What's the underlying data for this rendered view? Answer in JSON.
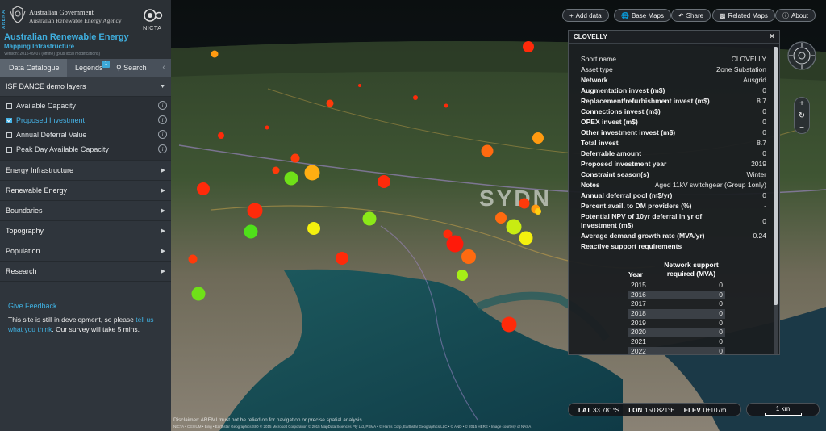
{
  "brand": {
    "arena": "ARENA",
    "gov_line1": "Australian Government",
    "gov_line2": "Australian Renewable Energy Agency",
    "partner": "NICTA",
    "title": "Australian Renewable Energy",
    "subtitle": "Mapping Infrastructure",
    "version": "Version: 2015-09-07 (offline) (plus local modifications)"
  },
  "sidebar": {
    "tabs": {
      "catalogue": "Data Catalogue",
      "legends": "Legends",
      "legends_badge": "1",
      "search": "Search"
    },
    "open_group": {
      "label": "ISF DANCE demo layers",
      "layers": [
        {
          "label": "Available Capacity",
          "checked": false
        },
        {
          "label": "Proposed Investment",
          "checked": true
        },
        {
          "label": "Annual Deferral Value",
          "checked": false
        },
        {
          "label": "Peak Day Available Capacity",
          "checked": false
        }
      ]
    },
    "groups": [
      "Energy Infrastructure",
      "Renewable Energy",
      "Boundaries",
      "Topography",
      "Population",
      "Research"
    ],
    "feedback": {
      "title": "Give Feedback",
      "text_before": "This site is still in development, so please ",
      "link": "tell us what you think",
      "text_after": ". Our survey will take 5 mins."
    }
  },
  "toolbar": {
    "add_data": "Add data",
    "base_maps": "Base Maps",
    "share": "Share",
    "related_maps": "Related Maps",
    "about": "About"
  },
  "map": {
    "place_label": "SYDN",
    "marker_colors": {
      "red": "#ff2a0a",
      "orange": "#ff6a10",
      "amber": "#ffae12",
      "yellow": "#f4f00e",
      "lime": "#a6ee16",
      "green": "#4fe01a"
    }
  },
  "panel": {
    "title": "CLOVELLY",
    "close": "×",
    "properties": [
      {
        "k": "Short name",
        "v": "CLOVELLY",
        "bold": false
      },
      {
        "k": "Asset type",
        "v": "Zone Substation",
        "bold": false
      },
      {
        "k": "Network",
        "v": "Ausgrid"
      },
      {
        "k": "Augmentation invest (m$)",
        "v": "0"
      },
      {
        "k": "Replacement/refurbishment invest (m$)",
        "v": "8.7"
      },
      {
        "k": "Connections invest (m$)",
        "v": "0"
      },
      {
        "k": "OPEX invest (m$)",
        "v": "0"
      },
      {
        "k": "Other investment invest (m$)",
        "v": "0"
      },
      {
        "k": "Total invest",
        "v": "8.7"
      },
      {
        "k": "Deferrable amount",
        "v": "0"
      },
      {
        "k": "Proposed investment year",
        "v": "2019"
      },
      {
        "k": "Constraint season(s)",
        "v": "Winter"
      },
      {
        "k": "Notes",
        "v": "Aged 11kV switchgear (Group 1only)"
      },
      {
        "k": "Annual deferral pool (m$/yr)",
        "v": "0"
      },
      {
        "k": "Percent avail. to DM providers (%)",
        "v": "-"
      },
      {
        "k": "Potential NPV of 10yr deferral in yr of investment (m$)",
        "v": "0",
        "tall": true
      },
      {
        "k": "Average demand growth rate (MVA/yr)",
        "v": "0.24"
      },
      {
        "k": "Reactive support requirements",
        "v": ""
      }
    ],
    "support_table": {
      "col1": "Year",
      "col2": "Network support required (MVA)",
      "rows": [
        [
          "2015",
          "0"
        ],
        [
          "2016",
          "0"
        ],
        [
          "2017",
          "0"
        ],
        [
          "2018",
          "0"
        ],
        [
          "2019",
          "0"
        ],
        [
          "2020",
          "0"
        ],
        [
          "2021",
          "0"
        ],
        [
          "2022",
          "0"
        ]
      ]
    }
  },
  "status": {
    "lat_label": "LAT",
    "lat": "33.781°S",
    "lon_label": "LON",
    "lon": "150.821°E",
    "elev_label": "ELEV",
    "elev": "0±107m",
    "scale": "1 km"
  },
  "disclaimer": "Disclaimer: AREMI must not be relied on for navigation or precise spatial analysis",
  "credits": "NICTA • CESIUM • Bing • Earthstar Geographics SIO © 2015 Microsoft Corporation © 2015 MapData Sciences Pty Ltd, PSMA • © Harris Corp, Earthstar Geographics LLC • © AND • © 2015 HERE • Image courtesy of NASA"
}
